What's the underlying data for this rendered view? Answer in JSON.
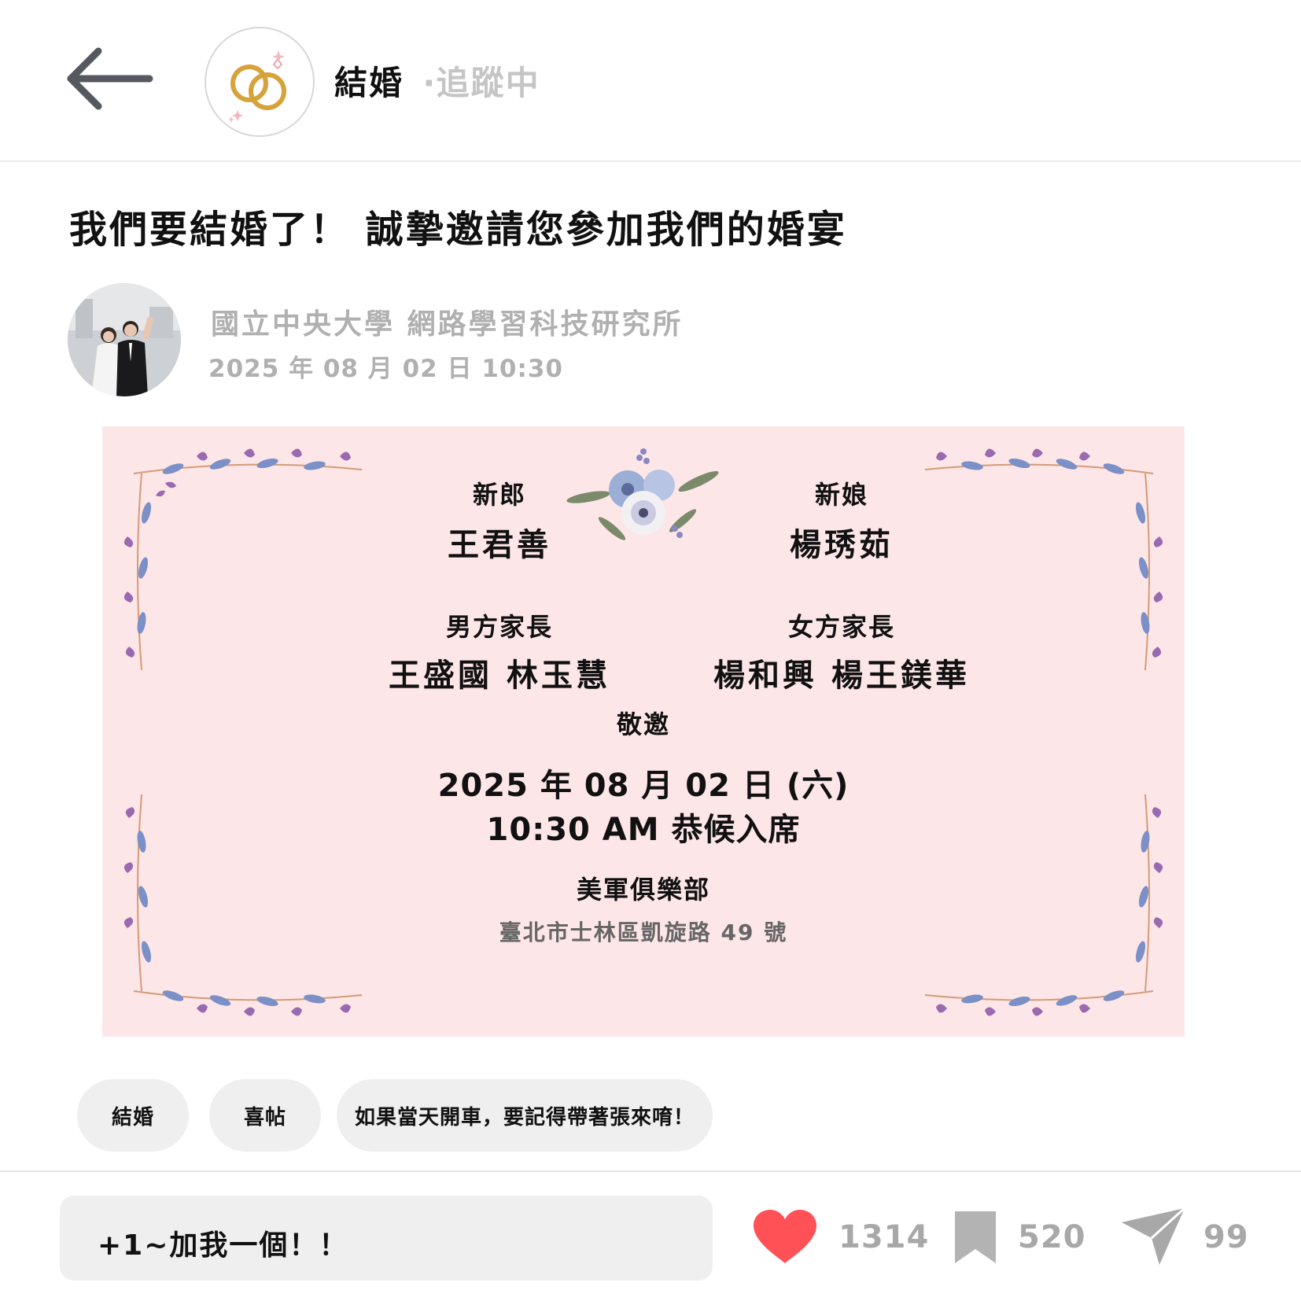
{
  "header": {
    "board_name": "結婚",
    "follow_status": "‧追蹤中"
  },
  "post": {
    "title": "我們要結婚了！ 誠摯邀請您參加我們的婚宴",
    "author": "國立中央大學  網路學習科技研究所",
    "date": "2025 年 08 月 02 日 10:30"
  },
  "invitation": {
    "groom_label": "新郎",
    "groom_name": "王君善",
    "bride_label": "新娘",
    "bride_name": "楊琇茹",
    "groom_parents_label": "男方家長",
    "groom_parents": "王盛國 林玉慧",
    "bride_parents_label": "女方家長",
    "bride_parents": "楊和興 楊王鎂華",
    "invite_word": "敬邀",
    "date_line": "2025 年 08 月 02 日 (六)",
    "time_line": "10:30 AM 恭候入席",
    "venue": "美軍俱樂部",
    "address": "臺北市士林區凱旋路 49 號"
  },
  "tags": [
    "結婚",
    "喜帖",
    "如果當天開車，要記得帶著張來唷！"
  ],
  "footer": {
    "comment_value": "+1~加我一個！！",
    "likes": "1314",
    "saves": "520",
    "shares": "99"
  },
  "icons": [
    "back-arrow-icon",
    "wedding-rings-icon",
    "heart-icon",
    "bookmark-icon",
    "paper-plane-icon"
  ],
  "colors": {
    "accent_heart": "#ff5156",
    "invitation_bg": "#fde6e7",
    "muted_text": "#b0b0b0",
    "ring_gold": "#d6a23a"
  }
}
